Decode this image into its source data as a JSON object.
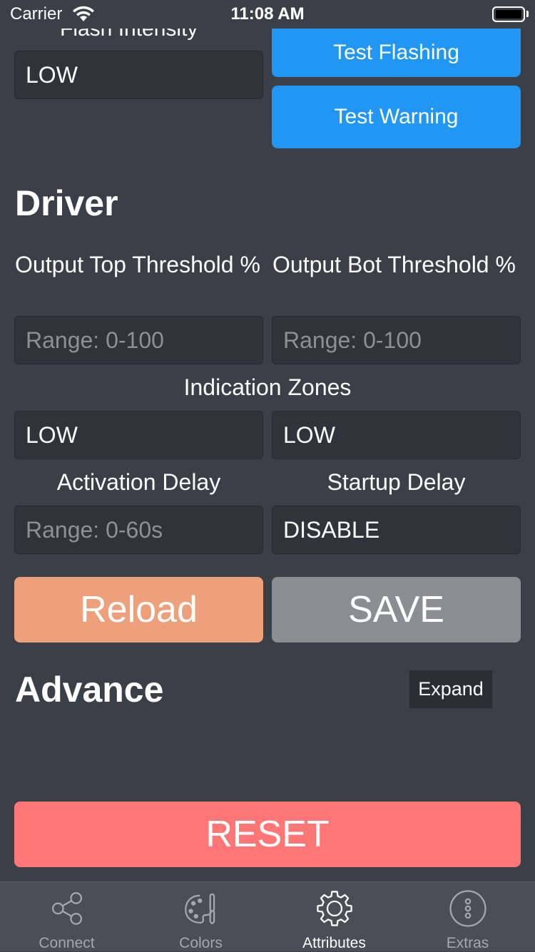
{
  "status_bar": {
    "carrier": "Carrier",
    "time": "11:08 AM"
  },
  "flash": {
    "label": "Flash Intensity",
    "value": "LOW",
    "test_flashing": "Test Flashing",
    "test_warning": "Test Warning"
  },
  "driver": {
    "title": "Driver",
    "top_threshold_label": "Output Top Threshold %",
    "bot_threshold_label": "Output Bot Threshold %",
    "top_threshold_placeholder": "Range: 0-100",
    "bot_threshold_placeholder": "Range: 0-100",
    "indication_zones_label": "Indication Zones",
    "zone_left_value": "LOW",
    "zone_right_value": "LOW",
    "activation_delay_label": "Activation Delay",
    "activation_delay_placeholder": "Range: 0-60s",
    "startup_delay_label": "Startup Delay",
    "startup_delay_value": "DISABLE",
    "reload": "Reload",
    "save": "SAVE"
  },
  "advance": {
    "title": "Advance",
    "expand": "Expand"
  },
  "reset": "RESET",
  "tabs": [
    {
      "label": "Connect",
      "icon": "share-icon",
      "active": false
    },
    {
      "label": "Colors",
      "icon": "palette-icon",
      "active": false
    },
    {
      "label": "Attributes",
      "icon": "gear-icon",
      "active": true
    },
    {
      "label": "Extras",
      "icon": "more-icon",
      "active": false
    }
  ],
  "colors": {
    "background": "#3b3f47",
    "field": "#30333a",
    "blue": "#2196f3",
    "reload": "#eda079",
    "save": "#8a8d91",
    "reset": "#ff7676",
    "tab_bar": "#4a4e57"
  }
}
